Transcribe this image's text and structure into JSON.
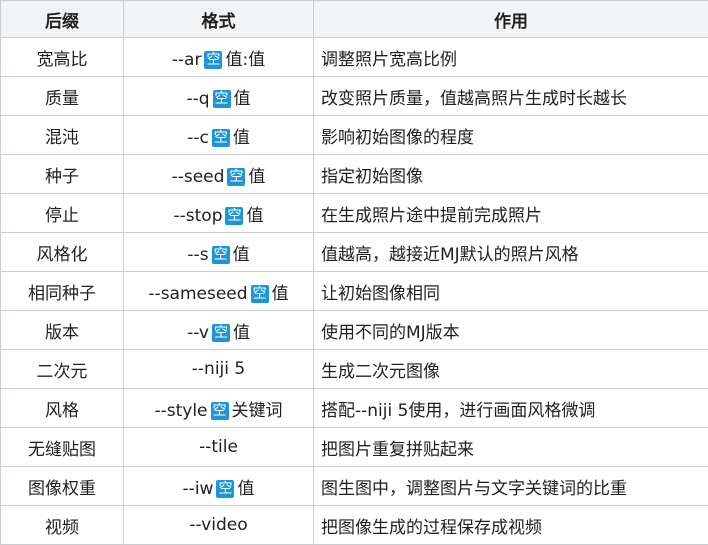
{
  "table": {
    "headers": [
      "后缀",
      "格式",
      "作用"
    ],
    "keyword_tag": "空",
    "rows": [
      {
        "name": "宽高比",
        "format": [
          "--ar",
          "值:值"
        ],
        "desc": "调整照片宽高比例"
      },
      {
        "name": "质量",
        "format": [
          "--q",
          "值"
        ],
        "desc": "改变照片质量，值越高照片生成时长越长"
      },
      {
        "name": "混沌",
        "format": [
          "--c",
          "值"
        ],
        "desc": "影响初始图像的程度"
      },
      {
        "name": "种子",
        "format": [
          "--seed",
          "值"
        ],
        "desc": "指定初始图像"
      },
      {
        "name": "停止",
        "format": [
          "--stop",
          "值"
        ],
        "desc": "在生成照片途中提前完成照片"
      },
      {
        "name": "风格化",
        "format": [
          "--s",
          "值"
        ],
        "desc": "值越高，越接近MJ默认的照片风格"
      },
      {
        "name": "相同种子",
        "format": [
          "--sameseed",
          "值"
        ],
        "desc": "让初始图像相同"
      },
      {
        "name": "版本",
        "format": [
          "--v",
          "值"
        ],
        "desc": "使用不同的MJ版本"
      },
      {
        "name": "二次元",
        "format": [
          "--niji 5"
        ],
        "desc": "生成二次元图像"
      },
      {
        "name": "风格",
        "format": [
          "--style",
          "关键词"
        ],
        "desc": "搭配--niji 5使用，进行画面风格微调"
      },
      {
        "name": "无缝贴图",
        "format": [
          "--tile"
        ],
        "desc": "把图片重复拼贴起来"
      },
      {
        "name": "图像权重",
        "format": [
          "--iw",
          "值"
        ],
        "desc": "图生图中，调整图片与文字关键词的比重"
      },
      {
        "name": "视频",
        "format": [
          "--video"
        ],
        "desc": "把图像生成的过程保存成视频"
      }
    ]
  }
}
